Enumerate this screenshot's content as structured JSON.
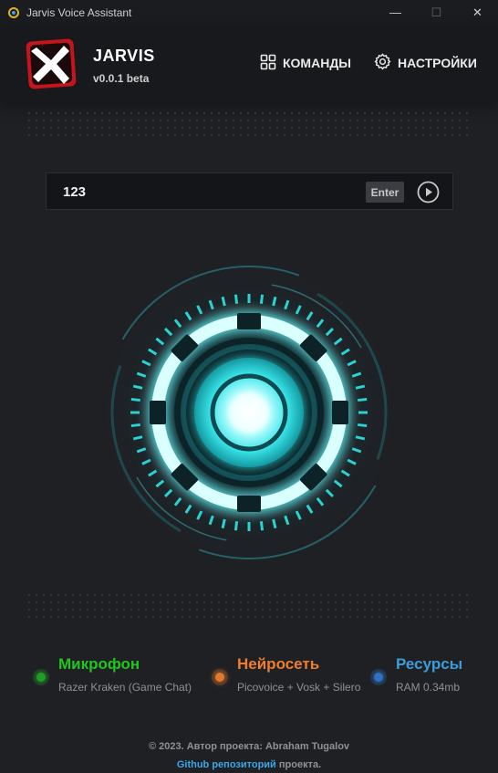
{
  "window": {
    "title": "Jarvis Voice Assistant",
    "minimize": "—",
    "maximize": "☐",
    "close": "✕"
  },
  "header": {
    "brand_name": "JARVIS",
    "version": "v0.0.1 beta",
    "nav": {
      "commands": "КОМАНДЫ",
      "settings": "НАСТРОЙКИ"
    }
  },
  "command": {
    "value": "123",
    "enter_label": "Enter"
  },
  "status": {
    "microphone": {
      "label": "Микрофон",
      "value": "Razer Kraken (Game Chat)",
      "color": "#22c41e"
    },
    "neural": {
      "label": "Нейросеть",
      "value": "Picovoice + Vosk + Silero",
      "color": "#f07c2e"
    },
    "resources": {
      "label": "Ресурсы",
      "value": "RAM 0.34mb",
      "color": "#3c9ddb"
    }
  },
  "footer": {
    "copyright": "© 2023. Автор проекта: Abraham Tugalov",
    "repo_link": "Github репозиторий",
    "repo_suffix": " проекта."
  },
  "colors": {
    "accent": "#2ce6e6",
    "background": "#1f2024"
  }
}
